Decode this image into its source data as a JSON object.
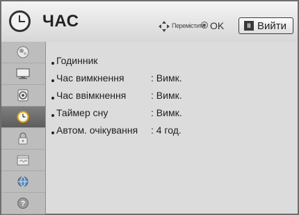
{
  "header": {
    "title": "ЧАС",
    "move_label": "Перемістити",
    "ok_label": "OK",
    "exit_label": "Вийти",
    "exit_key": "ІІ"
  },
  "sidebar": {
    "items": [
      {
        "icon": "picture-icon",
        "active": false
      },
      {
        "icon": "tv-screen-icon",
        "active": false
      },
      {
        "icon": "audio-icon",
        "active": false
      },
      {
        "icon": "time-clock-icon",
        "active": true
      },
      {
        "icon": "lock-icon",
        "active": false
      },
      {
        "icon": "options-icon",
        "active": false
      },
      {
        "icon": "network-icon",
        "active": false
      },
      {
        "icon": "help-icon",
        "active": false
      }
    ]
  },
  "menu": {
    "items": [
      {
        "label": "Годинник",
        "sep": "",
        "value": ""
      },
      {
        "label": "Час вимкнення",
        "sep": ": ",
        "value": "Вимк."
      },
      {
        "label": "Час ввімкнення",
        "sep": ": ",
        "value": "Вимк."
      },
      {
        "label": "Таймер сну",
        "sep": ": ",
        "value": "Вимк."
      },
      {
        "label": "Автом. очікування",
        "sep": ": ",
        "value": "4 год."
      }
    ]
  },
  "colors": {
    "header_bg": "#e6e6e6",
    "sidebar_bg": "#bdbdbd",
    "sidebar_active_bg": "#6e6e6e",
    "content_bg": "#dcdcdc",
    "border": "#6e6e6e"
  }
}
